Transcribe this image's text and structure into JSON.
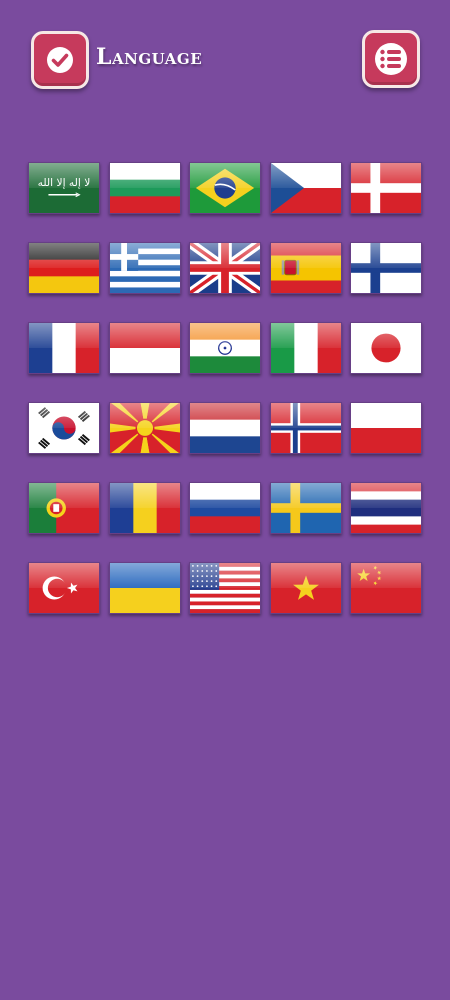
{
  "header": {
    "title": "Language",
    "confirm_icon": "check-icon",
    "menu_icon": "list-icon"
  },
  "colors": {
    "background": "#7a4b9e",
    "button": "#c63a5c",
    "button_border": "#f6e8e6"
  },
  "flags": [
    {
      "code": "sa",
      "name": "Saudi Arabia"
    },
    {
      "code": "bg",
      "name": "Bulgaria"
    },
    {
      "code": "br",
      "name": "Brazil"
    },
    {
      "code": "cz",
      "name": "Czech Republic"
    },
    {
      "code": "dk",
      "name": "Denmark"
    },
    {
      "code": "de",
      "name": "Germany"
    },
    {
      "code": "gr",
      "name": "Greece"
    },
    {
      "code": "gb",
      "name": "United Kingdom"
    },
    {
      "code": "es",
      "name": "Spain"
    },
    {
      "code": "fi",
      "name": "Finland"
    },
    {
      "code": "fr",
      "name": "France"
    },
    {
      "code": "id",
      "name": "Indonesia"
    },
    {
      "code": "in",
      "name": "India"
    },
    {
      "code": "it",
      "name": "Italy"
    },
    {
      "code": "jp",
      "name": "Japan"
    },
    {
      "code": "kr",
      "name": "South Korea"
    },
    {
      "code": "mk",
      "name": "North Macedonia"
    },
    {
      "code": "nl",
      "name": "Netherlands"
    },
    {
      "code": "no",
      "name": "Norway"
    },
    {
      "code": "pl",
      "name": "Poland"
    },
    {
      "code": "pt",
      "name": "Portugal"
    },
    {
      "code": "ro",
      "name": "Romania"
    },
    {
      "code": "ru",
      "name": "Russia"
    },
    {
      "code": "se",
      "name": "Sweden"
    },
    {
      "code": "th",
      "name": "Thailand"
    },
    {
      "code": "tr",
      "name": "Turkey"
    },
    {
      "code": "ua",
      "name": "Ukraine"
    },
    {
      "code": "us",
      "name": "United States"
    },
    {
      "code": "vn",
      "name": "Vietnam"
    },
    {
      "code": "cn",
      "name": "China"
    }
  ]
}
